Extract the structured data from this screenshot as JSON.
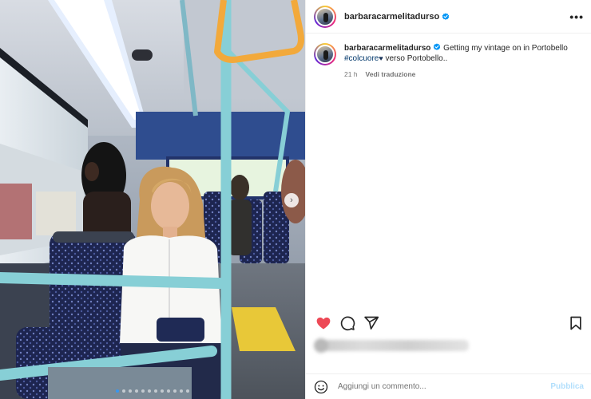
{
  "post": {
    "username": "barbaracarmelitadurso",
    "verified": true,
    "more_icon": "more-horizontal-icon"
  },
  "caption": {
    "username": "barbaracarmelitadurso",
    "text_before": "Getting my vintage on in Portobello",
    "hashtag": "#colcuore",
    "heart": "♥",
    "text_after": " verso Portobello..",
    "timestamp": "21 h",
    "translate": "Vedi traduzione"
  },
  "actions": {
    "like_icon": "heart-filled-icon",
    "comment_icon": "comment-icon",
    "share_icon": "share-icon",
    "save_icon": "bookmark-icon",
    "like_color": "#ed4956"
  },
  "comment": {
    "placeholder": "Aggiungi un commento...",
    "publish_label": "Pubblica",
    "emoji_icon": "emoji-icon"
  },
  "carousel": {
    "total_slides": 12,
    "active_slide": 1,
    "next_icon": "chevron-right-icon"
  },
  "colors": {
    "accent": "#0095f6",
    "hashtag": "#00376b",
    "muted": "#737373",
    "bus_rail": "#7fc6cf",
    "handle": "#f2a93b"
  }
}
